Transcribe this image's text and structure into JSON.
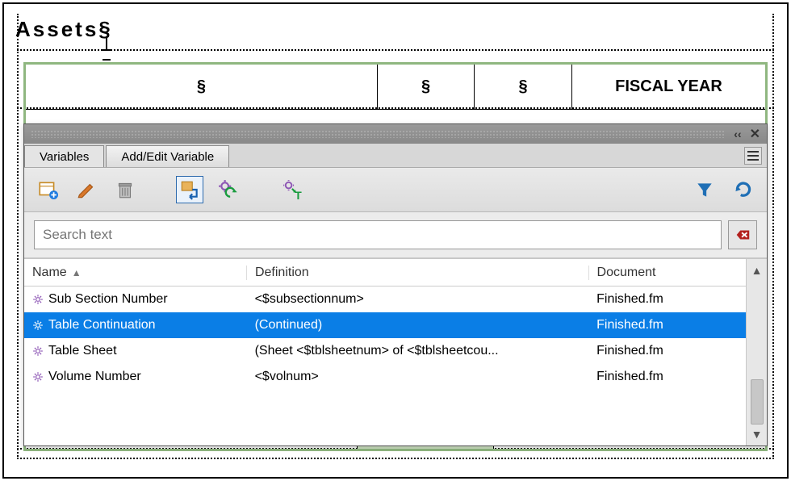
{
  "doc": {
    "title": "Assets§"
  },
  "tableHeader": {
    "c0": "§",
    "c1": "§",
    "c2": "§",
    "c3": "FISCAL YEAR"
  },
  "panel": {
    "tabs": {
      "variables": "Variables",
      "addEdit": "Add/Edit Variable"
    },
    "search": {
      "placeholder": "Search text"
    },
    "columns": {
      "name": "Name",
      "definition": "Definition",
      "document": "Document"
    },
    "rows": [
      {
        "name": "Sub Section Number",
        "definition": "<$subsectionnum>",
        "document": "Finished.fm",
        "selected": false
      },
      {
        "name": "Table Continuation",
        "definition": "(Continued)",
        "document": "Finished.fm",
        "selected": true
      },
      {
        "name": "Table Sheet",
        "definition": "(Sheet <$tblsheetnum> of <$tblsheetcou...",
        "document": "Finished.fm",
        "selected": false
      },
      {
        "name": "Volume Number",
        "definition": "<$volnum>",
        "document": "Finished.fm",
        "selected": false
      }
    ]
  }
}
